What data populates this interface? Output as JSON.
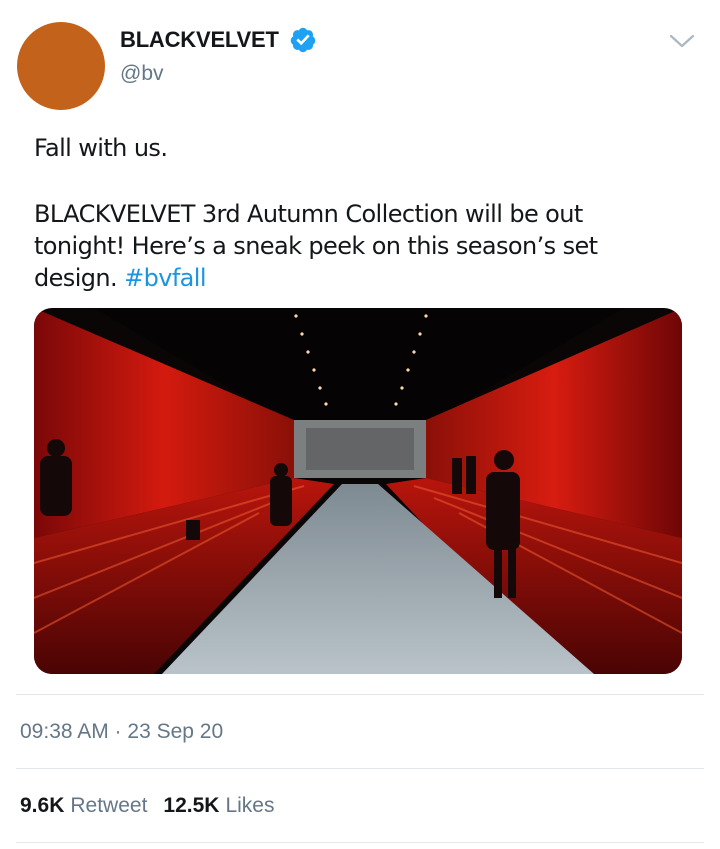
{
  "author": {
    "display_name": "BLACKVELVET",
    "handle": "@bv",
    "avatar_color": "#c2621b",
    "verified": true,
    "verified_icon": "verified-badge-icon"
  },
  "menu_icon": "chevron-down-icon",
  "tweet": {
    "line1": "Fall with us.",
    "body": "BLACKVELVET 3rd Autumn Collection will be out tonight! Here’s a sneak peek on this season’s set design.",
    "hashtag": "#bvfall"
  },
  "media": {
    "image_subject": "runway-photo"
  },
  "timestamp": "09:38 AM · 23 Sep 20",
  "stats": {
    "retweets_count": "9.6K",
    "retweets_label": "Retweet",
    "likes_count": "12.5K",
    "likes_label": "Likes"
  },
  "colors": {
    "link": "#1b95e0",
    "secondary_text": "#657786",
    "divider": "#e1e8ed",
    "verified": "#1da1f2"
  }
}
